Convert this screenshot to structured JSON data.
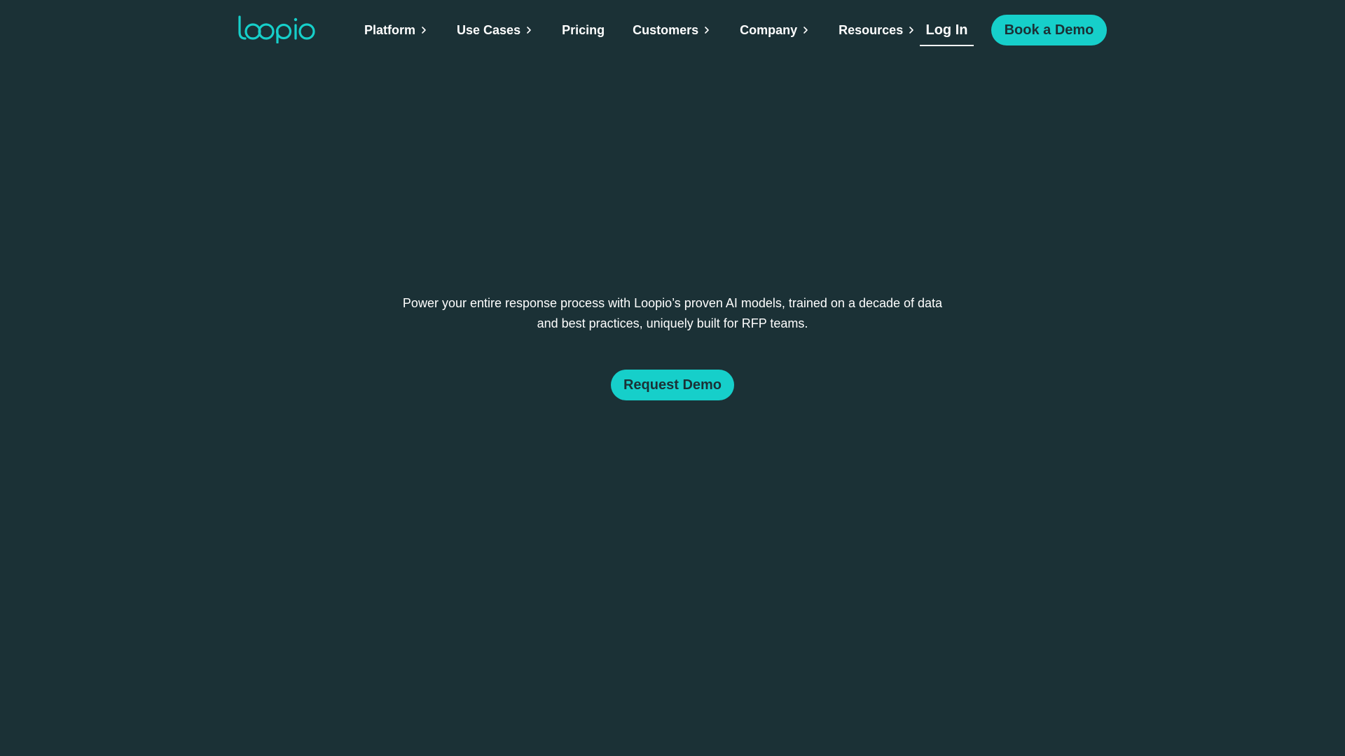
{
  "colors": {
    "background": "#1b3136",
    "accent": "#16cfca",
    "text": "#ffffff"
  },
  "header": {
    "logo_text": "loopio",
    "nav": [
      {
        "label": "Platform",
        "has_submenu": true,
        "icon": "chevron-right-icon"
      },
      {
        "label": "Use Cases",
        "has_submenu": true,
        "icon": "chevron-right-icon"
      },
      {
        "label": "Pricing",
        "has_submenu": false
      },
      {
        "label": "Customers",
        "has_submenu": true,
        "icon": "chevron-right-icon"
      },
      {
        "label": "Company",
        "has_submenu": true,
        "icon": "chevron-right-icon"
      },
      {
        "label": "Resources",
        "has_submenu": true,
        "icon": "chevron-right-icon"
      }
    ],
    "login_label": "Log In",
    "cta_label": "Book a Demo"
  },
  "hero": {
    "description_line1": "Power your entire response process with Loopio’s proven AI models, trained on a decade of data",
    "description_line2": "and best practices, uniquely built for RFP teams.",
    "cta_label": "Request Demo"
  }
}
